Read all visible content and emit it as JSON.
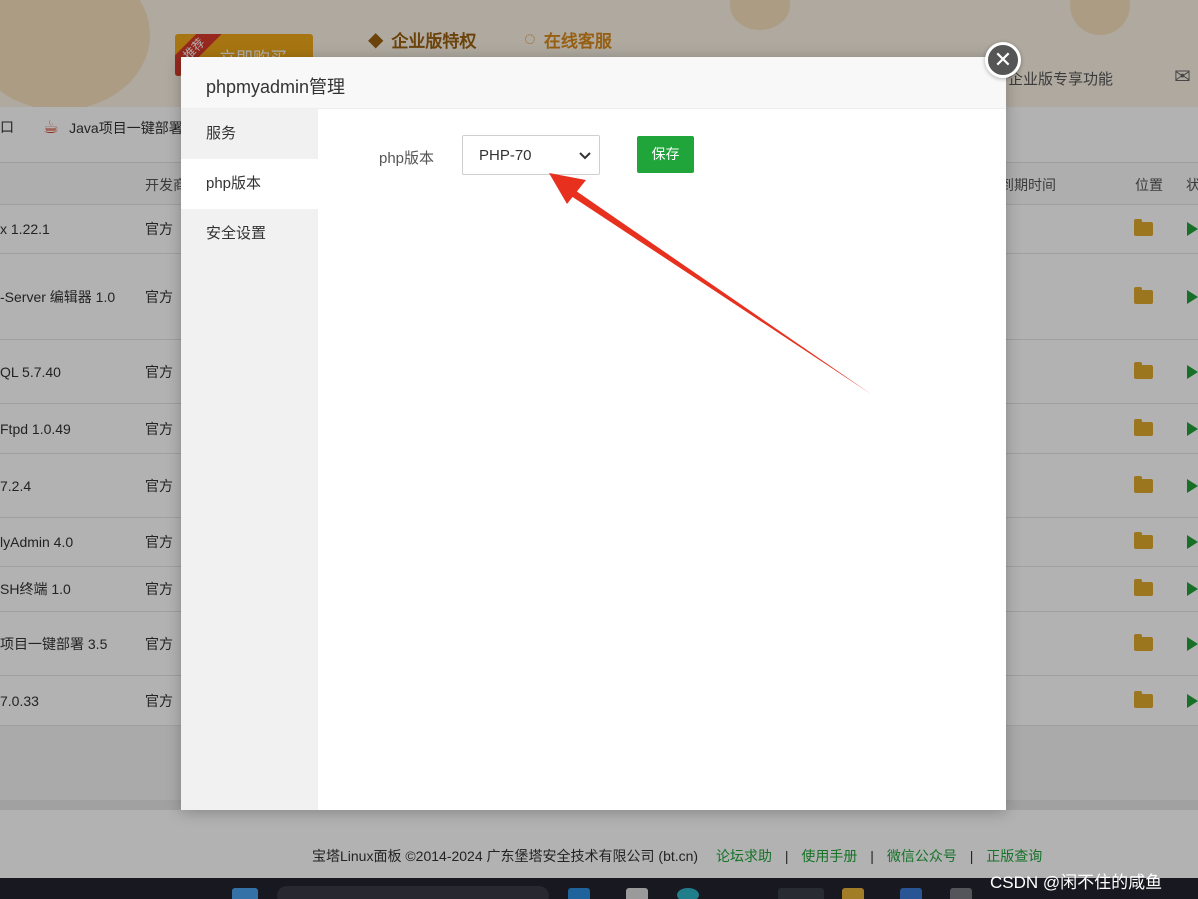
{
  "header": {
    "promo_label": "立即购买",
    "promo_ribbon": "推荐",
    "enterprise_label": "企业版特权",
    "service_label": "在线客服",
    "enterprise_feature_label": "企业版专享功能"
  },
  "nav": {
    "items": [
      {
        "label": "口"
      },
      {
        "label": "Java项目一键部署"
      }
    ]
  },
  "table": {
    "columns": {
      "developer": "开发商",
      "expire": "到期时间",
      "location": "位置",
      "status": "状"
    },
    "rows": [
      {
        "name": "x 1.22.1",
        "dev": "官方"
      },
      {
        "name": "-Server 编辑器 1.0",
        "dev": "官方"
      },
      {
        "name": "QL 5.7.40",
        "dev": "官方"
      },
      {
        "name": "Ftpd 1.0.49",
        "dev": "官方"
      },
      {
        "name": " 7.2.4",
        "dev": "官方"
      },
      {
        "name": "lyAdmin 4.0",
        "dev": "官方"
      },
      {
        "name": "SH终端 1.0",
        "dev": "官方"
      },
      {
        "name": "项目一键部署 3.5",
        "dev": "官方"
      },
      {
        "name": "7.0.33",
        "dev": "官方"
      }
    ]
  },
  "footer": {
    "copyright": "宝塔Linux面板 ©2014-2024 广东堡塔安全技术有限公司 (bt.cn)",
    "links": [
      "论坛求助",
      "使用手册",
      "微信公众号",
      "正版查询"
    ],
    "separator": "|"
  },
  "watermark": "CSDN @闲不住的咸鱼",
  "modal": {
    "title": "phpmyadmin管理",
    "close_symbol": "✕",
    "menu": [
      {
        "label": "服务",
        "active": false
      },
      {
        "label": "php版本",
        "active": true
      },
      {
        "label": "安全设置",
        "active": false
      }
    ],
    "form": {
      "php_version_label": "php版本",
      "php_version_value": "PHP-70",
      "save_label": "保存"
    }
  },
  "colors": {
    "accent_green": "#20a53a",
    "arrow_red": "#e8301f",
    "promo_orange": "#f0a91b"
  }
}
